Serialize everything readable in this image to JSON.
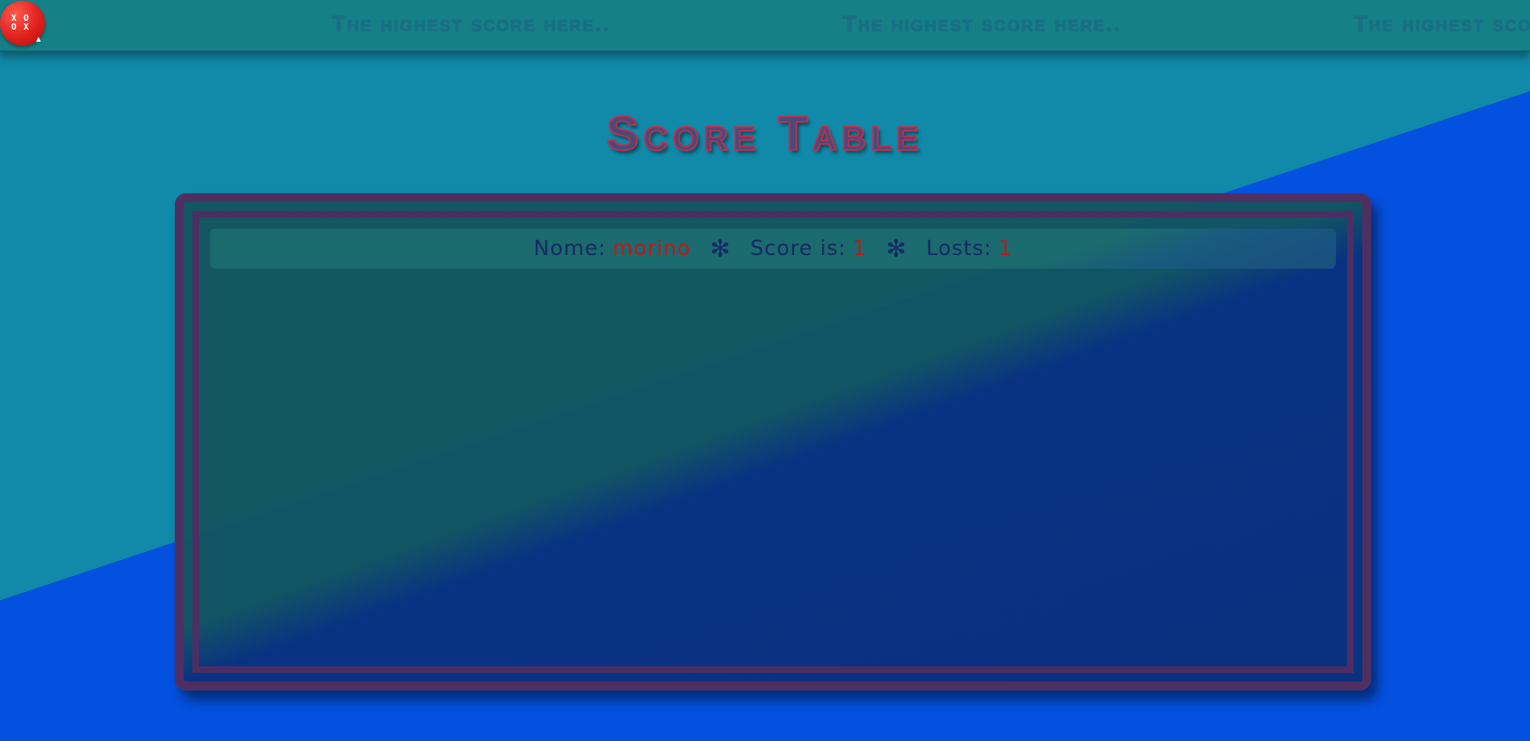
{
  "app": {
    "logo_text": "X O\nO X"
  },
  "marquee": {
    "items": [
      "The highest score here..",
      "The highest score here..",
      "The highest score here.."
    ]
  },
  "page": {
    "title": "Score Table"
  },
  "scores": [
    {
      "name_label": "Nome:",
      "name": "morino",
      "score_label": "Score is:",
      "score": "1",
      "losts_label": "Losts:",
      "losts": "1",
      "separator": "✻"
    }
  ],
  "colors": {
    "background_upper": "#1189a8",
    "background_lower": "#0450df",
    "topbar": "#168087",
    "panel_border": "#4f2f62",
    "value_red": "#b81c1c",
    "label_navy": "#152a63",
    "title_stroke": "#c22d4a",
    "logo_red": "#e0201c"
  }
}
